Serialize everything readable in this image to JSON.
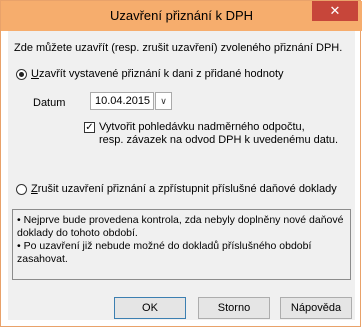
{
  "window": {
    "title": "Uzavření přiznání k DPH",
    "close_icon": "close-icon"
  },
  "intro_text": "Zde můžete uzavřít (resp. zrušit uzavření) zvoleného přiznání DPH.",
  "option_close": {
    "label_first": "U",
    "label_rest": "zavřít vystavené přiznání k dani z přidané hodnoty",
    "checked": true
  },
  "date": {
    "label": "Datum",
    "value": "10.04.2015",
    "button_icon": "dropdown-arrow-icon"
  },
  "create_claim": {
    "line1": "Vytvořit pohledávku nadměrného odpočtu,",
    "line2": "resp. závazek na odvod DPH k uvedenému datu.",
    "checked": true
  },
  "option_cancel": {
    "label_first": "Z",
    "label_rest": "rušit uzavření přiznání a zpřístupnit příslušné daňové doklady",
    "checked": false
  },
  "info": {
    "line1": "• Nejprve bude provedena kontrola, zda nebyly doplněny nové daňové",
    "line2": "doklady do tohoto období.",
    "line3": "• Po uzavření již nebude možné do dokladů příslušného období",
    "line4": "zasahovat."
  },
  "buttons": {
    "ok": "OK",
    "cancel": "Storno",
    "help": "Nápověda"
  }
}
